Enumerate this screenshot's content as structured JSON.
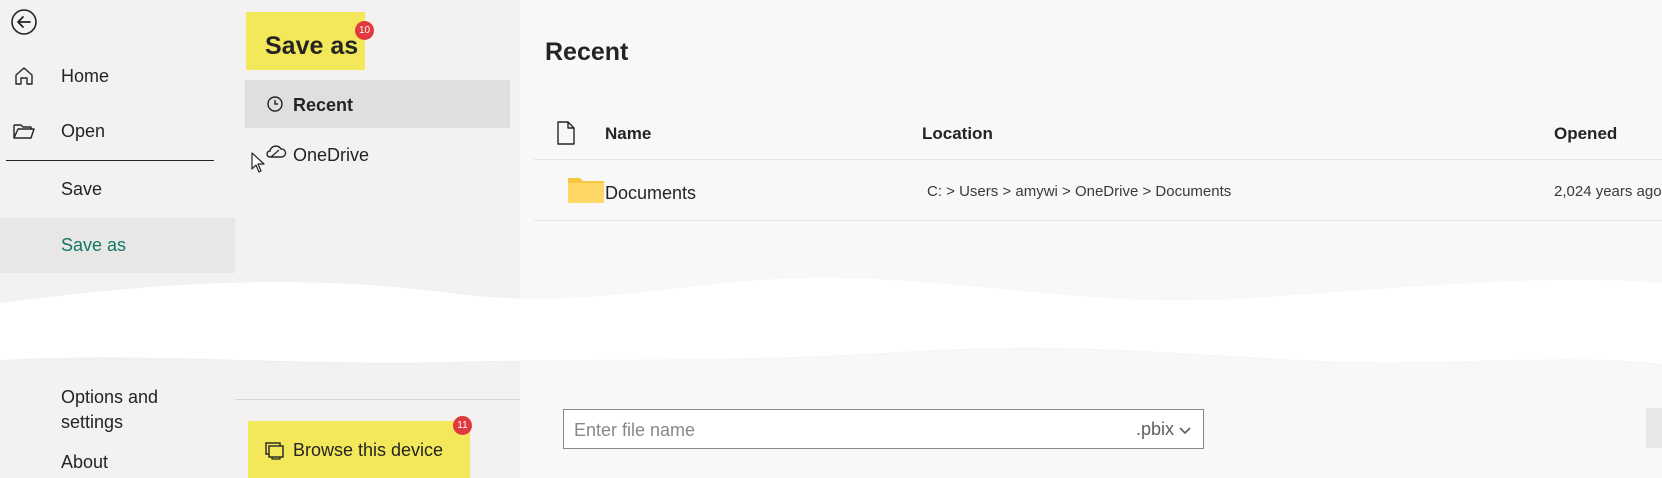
{
  "nav": {
    "items": [
      {
        "label": "Home"
      },
      {
        "label": "Open"
      },
      {
        "label": "Save"
      },
      {
        "label": "Save as"
      },
      {
        "label": "Options and settings"
      },
      {
        "label": "About"
      }
    ]
  },
  "saveas": {
    "title": "Save as",
    "title_badge": "10",
    "locations": [
      {
        "label": "Recent"
      },
      {
        "label": "OneDrive"
      }
    ],
    "browse_label": "Browse this device",
    "browse_badge": "11"
  },
  "main": {
    "title": "Recent",
    "columns": [
      "Name",
      "Location",
      "Opened"
    ],
    "rows": [
      {
        "name": "Documents",
        "location": "C: > Users > amywi > OneDrive > Documents",
        "opened": "2,024 years ago"
      }
    ],
    "filename_placeholder": "Enter file name",
    "extension": ".pbix"
  },
  "colors": {
    "highlight": "#f2e85a",
    "accent": "#117865",
    "badge": "#e0393e",
    "folder": "#f8c545"
  }
}
